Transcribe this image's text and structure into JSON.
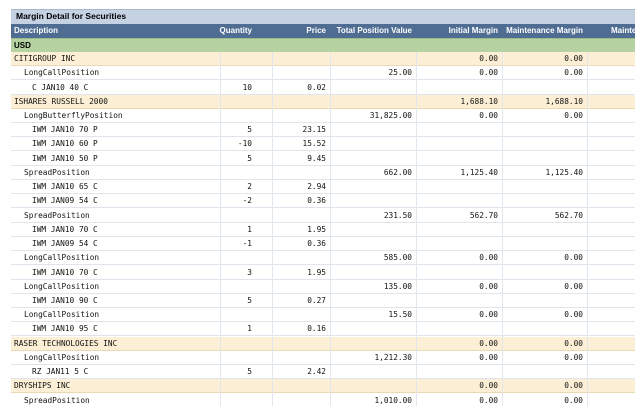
{
  "title": "Margin Detail for Securities",
  "columns": [
    "Description",
    "Quantity",
    "Price",
    "Total Position Value",
    "Initial Margin",
    "Maintenance Margin",
    "Mainte"
  ],
  "currency": "USD",
  "rows": [
    {
      "type": "sec",
      "cells": [
        "CITIGROUP INC",
        "",
        "",
        "",
        "0.00",
        "0.00"
      ]
    },
    {
      "type": "pos",
      "cells": [
        "LongCallPosition",
        "",
        "",
        "25.00",
        "0.00",
        "0.00"
      ]
    },
    {
      "type": "leg",
      "cells": [
        "C JAN10 40 C",
        "10",
        "0.02",
        "",
        "",
        ""
      ]
    },
    {
      "type": "sec",
      "cells": [
        "ISHARES RUSSELL 2000",
        "",
        "",
        "",
        "1,688.10",
        "1,688.10"
      ]
    },
    {
      "type": "pos",
      "cells": [
        "LongButterflyPosition",
        "",
        "",
        "31,825.00",
        "0.00",
        "0.00"
      ]
    },
    {
      "type": "leg",
      "cells": [
        "IWM JAN10 70 P",
        "5",
        "23.15",
        "",
        "",
        ""
      ]
    },
    {
      "type": "leg",
      "cells": [
        "IWM JAN10 60 P",
        "-10",
        "15.52",
        "",
        "",
        ""
      ]
    },
    {
      "type": "leg",
      "cells": [
        "IWM JAN10 50 P",
        "5",
        "9.45",
        "",
        "",
        ""
      ]
    },
    {
      "type": "pos",
      "cells": [
        "SpreadPosition",
        "",
        "",
        "662.00",
        "1,125.40",
        "1,125.40"
      ]
    },
    {
      "type": "leg",
      "cells": [
        "IWM JAN10 65 C",
        "2",
        "2.94",
        "",
        "",
        ""
      ]
    },
    {
      "type": "leg",
      "cells": [
        "IWM JAN09 54 C",
        "-2",
        "0.36",
        "",
        "",
        ""
      ]
    },
    {
      "type": "pos",
      "cells": [
        "SpreadPosition",
        "",
        "",
        "231.50",
        "562.70",
        "562.70"
      ]
    },
    {
      "type": "leg",
      "cells": [
        "IWM JAN10 70 C",
        "1",
        "1.95",
        "",
        "",
        ""
      ]
    },
    {
      "type": "leg",
      "cells": [
        "IWM JAN09 54 C",
        "-1",
        "0.36",
        "",
        "",
        ""
      ]
    },
    {
      "type": "pos",
      "cells": [
        "LongCallPosition",
        "",
        "",
        "585.00",
        "0.00",
        "0.00"
      ]
    },
    {
      "type": "leg",
      "cells": [
        "IWM JAN10 70 C",
        "3",
        "1.95",
        "",
        "",
        ""
      ]
    },
    {
      "type": "pos",
      "cells": [
        "LongCallPosition",
        "",
        "",
        "135.00",
        "0.00",
        "0.00"
      ]
    },
    {
      "type": "leg",
      "cells": [
        "IWM JAN10 90 C",
        "5",
        "0.27",
        "",
        "",
        ""
      ]
    },
    {
      "type": "pos",
      "cells": [
        "LongCallPosition",
        "",
        "",
        "15.50",
        "0.00",
        "0.00"
      ]
    },
    {
      "type": "leg",
      "cells": [
        "IWM JAN10 95 C",
        "1",
        "0.16",
        "",
        "",
        ""
      ]
    },
    {
      "type": "sec",
      "cells": [
        "RASER TECHNOLOGIES INC",
        "",
        "",
        "",
        "0.00",
        "0.00"
      ]
    },
    {
      "type": "pos",
      "cells": [
        "LongCallPosition",
        "",
        "",
        "1,212.30",
        "0.00",
        "0.00"
      ]
    },
    {
      "type": "leg",
      "cells": [
        "RZ JAN11 5 C",
        "5",
        "2.42",
        "",
        "",
        ""
      ]
    },
    {
      "type": "sec",
      "cells": [
        "DRYSHIPS INC",
        "",
        "",
        "",
        "0.00",
        "0.00"
      ]
    },
    {
      "type": "pos",
      "cells": [
        "SpreadPosition",
        "",
        "",
        "1,010.00",
        "0.00",
        "0.00"
      ]
    }
  ]
}
